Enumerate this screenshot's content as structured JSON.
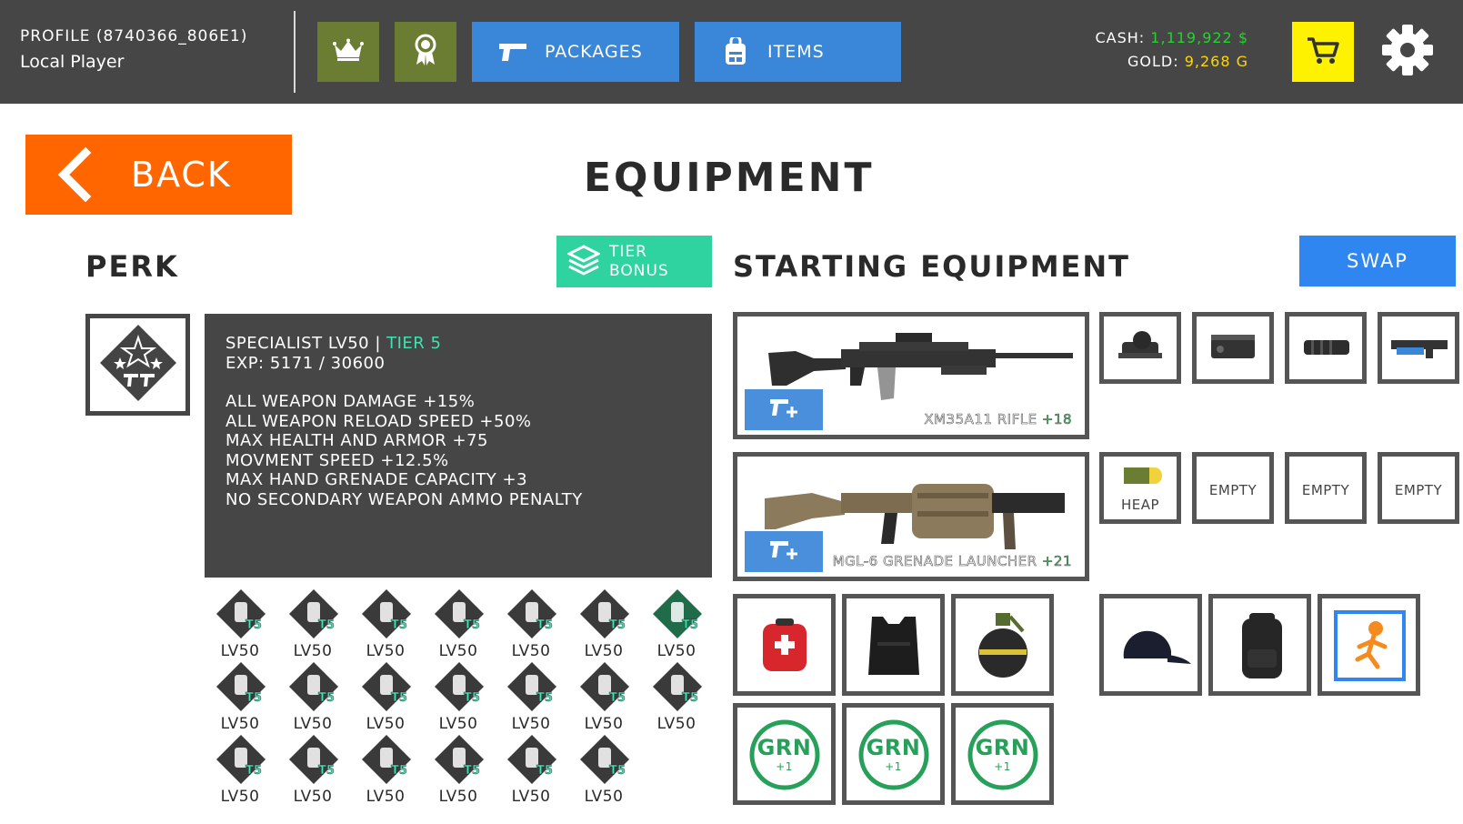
{
  "header": {
    "profile_id": "PROFILE (8740366_806E1)",
    "profile_name": "Local Player",
    "packages_label": "PACKAGES",
    "items_label": "ITEMS",
    "cash_label": "CASH:",
    "cash_value": "1,119,922 $",
    "gold_label": "GOLD:",
    "gold_value": "9,268 G",
    "icons": {
      "rank": "crown-icon",
      "achievements": "ribbon-icon",
      "packages": "pistol-icon",
      "items": "backpack-icon",
      "shop": "cart-icon",
      "settings": "gear-icon"
    },
    "colors": {
      "bar": "#464646",
      "olive": "#6b7d32",
      "blue": "#3a86d8",
      "cart": "#fff200",
      "cash": "#27d12f",
      "gold": "#ffd50a"
    }
  },
  "back_label": "BACK",
  "page_title": "EQUIPMENT",
  "perk": {
    "title": "PERK",
    "tier_bonus_line1": "TIER",
    "tier_bonus_line2": "BONUS",
    "name": "SPECIALIST LV50 | ",
    "tier": "TIER 5",
    "exp": "EXP: 5171 / 30600",
    "bonuses": [
      "ALL WEAPON DAMAGE +15%",
      "ALL WEAPON RELOAD SPEED +50%",
      "MAX HEALTH AND ARMOR +75",
      "MOVMENT SPEED +12.5%",
      "MAX HAND GRENADE CAPACITY +3",
      "NO SECONDARY WEAPON AMMO PENALTY"
    ],
    "badges": [
      {
        "icon": "pistol-icon",
        "level": "LV50",
        "tag": "T5"
      },
      {
        "icon": "shield-icon",
        "level": "LV50",
        "tag": "T5"
      },
      {
        "icon": "sniper-icon",
        "level": "LV50",
        "tag": "T5"
      },
      {
        "icon": "shotgun-icon",
        "level": "LV50",
        "tag": "T5"
      },
      {
        "icon": "smg-icon",
        "level": "LV50",
        "tag": "T5"
      },
      {
        "icon": "bullets-icon",
        "level": "LV50",
        "tag": "T5"
      },
      {
        "icon": "specialist-icon",
        "level": "LV50",
        "tag": "T5"
      },
      {
        "icon": "knife-icon",
        "level": "LV50",
        "tag": "T5"
      },
      {
        "icon": "rifle-icon",
        "level": "LV50",
        "tag": "T5"
      },
      {
        "icon": "crosshair-icon",
        "level": "LV50",
        "tag": "T5"
      },
      {
        "icon": "fire-skull-icon",
        "level": "LV50",
        "tag": "T5"
      },
      {
        "icon": "turret-icon",
        "level": "LV50",
        "tag": "T5"
      },
      {
        "icon": "blade-icon",
        "level": "LV50",
        "tag": "T5"
      },
      {
        "icon": "medic-icon",
        "level": "LV50",
        "tag": "T5"
      },
      {
        "icon": "armor-icon",
        "level": "LV50",
        "tag": "T5"
      },
      {
        "icon": "swat-icon",
        "level": "LV50",
        "tag": "T5"
      },
      {
        "icon": "badge-shield-icon",
        "level": "LV50",
        "tag": "T5"
      },
      {
        "icon": "helmet-icon",
        "level": "LV50",
        "tag": "T5"
      },
      {
        "icon": "wings-icon",
        "level": "LV50",
        "tag": "T5"
      },
      {
        "icon": "grenade-icon",
        "level": "LV50",
        "tag": "T5"
      }
    ]
  },
  "starting_equipment": {
    "title": "STARTING EQUIPMENT",
    "swap_label": "SWAP",
    "primary": {
      "name": "XM35A11 RIFLE",
      "plus": "+18",
      "attachments": [
        "scope-icon",
        "laser-module-icon",
        "suppressor-icon",
        "grenade-launcher-attachment-icon"
      ]
    },
    "secondary": {
      "name": "MGL-6 GRENADE LAUNCHER",
      "plus": "+21",
      "ammo_label": "HEAP",
      "empty_label": "EMPTY"
    },
    "gear": [
      "first-aid-kit-icon",
      "body-armor-icon",
      "frag-grenade-icon"
    ],
    "grenade_label": "GRN",
    "grenade_sub": "+1",
    "cosmetics": [
      "cap-icon",
      "backpack-icon",
      "character-icon"
    ]
  }
}
